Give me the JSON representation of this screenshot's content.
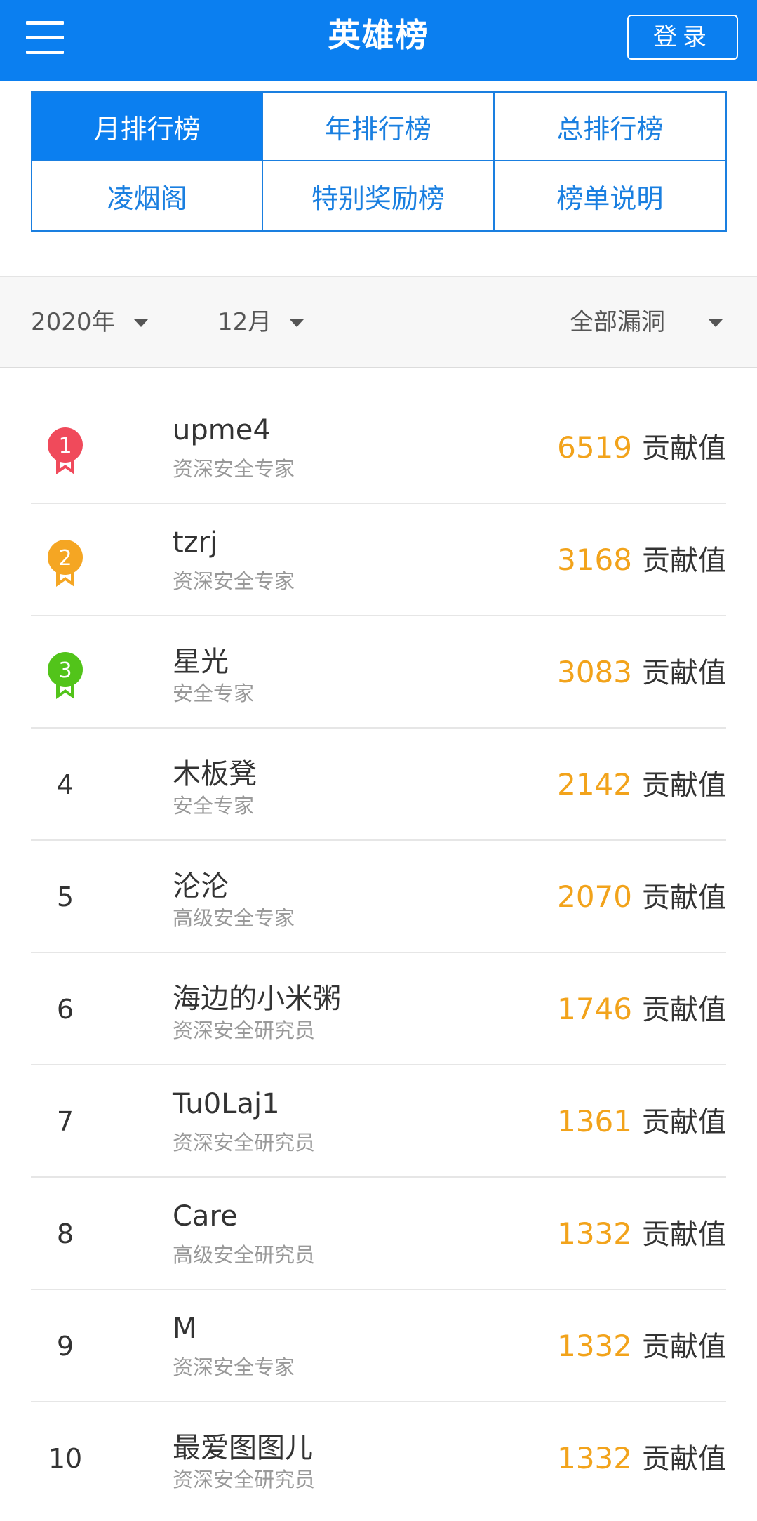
{
  "header": {
    "title": "英雄榜",
    "login_label": "登录",
    "menu_icon": "menu-icon",
    "brand_color": "#0b7ff0"
  },
  "tabs": [
    {
      "label": "月排行榜",
      "active": true
    },
    {
      "label": "年排行榜",
      "active": false
    },
    {
      "label": "总排行榜",
      "active": false
    },
    {
      "label": "凌烟阁",
      "active": false
    },
    {
      "label": "特别奖励榜",
      "active": false
    },
    {
      "label": "榜单说明",
      "active": false
    }
  ],
  "filters": {
    "year": "2020年",
    "month": "12月",
    "category": "全部漏洞"
  },
  "score_unit": "贡献值",
  "accent_color": "#f2a31b",
  "medal_colors": [
    "#f04a5b",
    "#f5a623",
    "#52c41a"
  ],
  "ranking": [
    {
      "rank": "1",
      "name": "upme4",
      "title": "资深安全专家",
      "score": "6519"
    },
    {
      "rank": "2",
      "name": "tzrj",
      "title": "资深安全专家",
      "score": "3168"
    },
    {
      "rank": "3",
      "name": "星光",
      "title": "安全专家",
      "score": "3083"
    },
    {
      "rank": "4",
      "name": "木板凳",
      "title": "安全专家",
      "score": "2142"
    },
    {
      "rank": "5",
      "name": "沦沦",
      "title": "高级安全专家",
      "score": "2070"
    },
    {
      "rank": "6",
      "name": "海边的小米粥",
      "title": "资深安全研究员",
      "score": "1746"
    },
    {
      "rank": "7",
      "name": "Tu0Laj1",
      "title": "资深安全研究员",
      "score": "1361"
    },
    {
      "rank": "8",
      "name": "Care",
      "title": "高级安全研究员",
      "score": "1332"
    },
    {
      "rank": "9",
      "name": "M",
      "title": "资深安全专家",
      "score": "1332"
    },
    {
      "rank": "10",
      "name": "最爱图图儿",
      "title": "资深安全研究员",
      "score": "1332"
    }
  ]
}
